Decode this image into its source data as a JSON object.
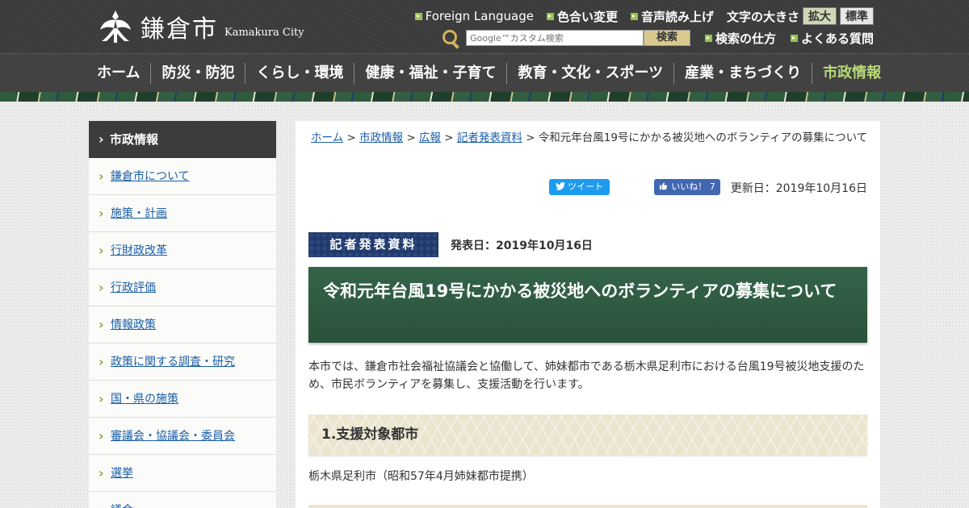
{
  "header": {
    "logo_text": "鎌倉市",
    "logo_sub": "Kamakura City",
    "links_row1": [
      "Foreign Language",
      "色合い変更",
      "音声読み上げ"
    ],
    "fontsize_label": "文字の大きさ",
    "fontsize_big": "拡大",
    "fontsize_std": "標準",
    "search_placeholder": "Google™カスタム検索",
    "search_button": "検索",
    "links_row2": [
      "検索の仕方",
      "よくある質問"
    ]
  },
  "gnav": [
    "ホーム",
    "防災・防犯",
    "くらし・環境",
    "健康・福祉・子育て",
    "教育・文化・スポーツ",
    "産業・まちづくり",
    "市政情報"
  ],
  "sidebar": {
    "heading": "市政情報",
    "items": [
      "鎌倉市について",
      "施策・計画",
      "行財政改革",
      "行政評価",
      "情報政策",
      "政策に関する調査・研究",
      "国・県の施策",
      "審議会・協議会・委員会",
      "選挙",
      "議会"
    ]
  },
  "breadcrumb": {
    "links": [
      "ホーム",
      "市政情報",
      "広報",
      "記者発表資料"
    ],
    "separator": ">",
    "current": "令和元年台風19号にかかる被災地へのボランティアの募集について"
  },
  "social": {
    "tweet": "ツイート",
    "like": "いいね！",
    "like_count": "7"
  },
  "updated": "更新日：2019年10月16日",
  "press": {
    "label": "記者発表資料",
    "date": "発表日：2019年10月16日"
  },
  "title": "令和元年台風19号にかかる被災地へのボランティアの募集について",
  "intro": "本市では、鎌倉市社会福祉協議会と協働して、姉妹都市である栃木県足利市における台風19号被災地支援のため、市民ボランティアを募集し、支援活動を行います。",
  "section1": {
    "heading": "1.支援対象都市",
    "text": "栃木県足利市（昭和57年4月姉妹都市提携）"
  }
}
